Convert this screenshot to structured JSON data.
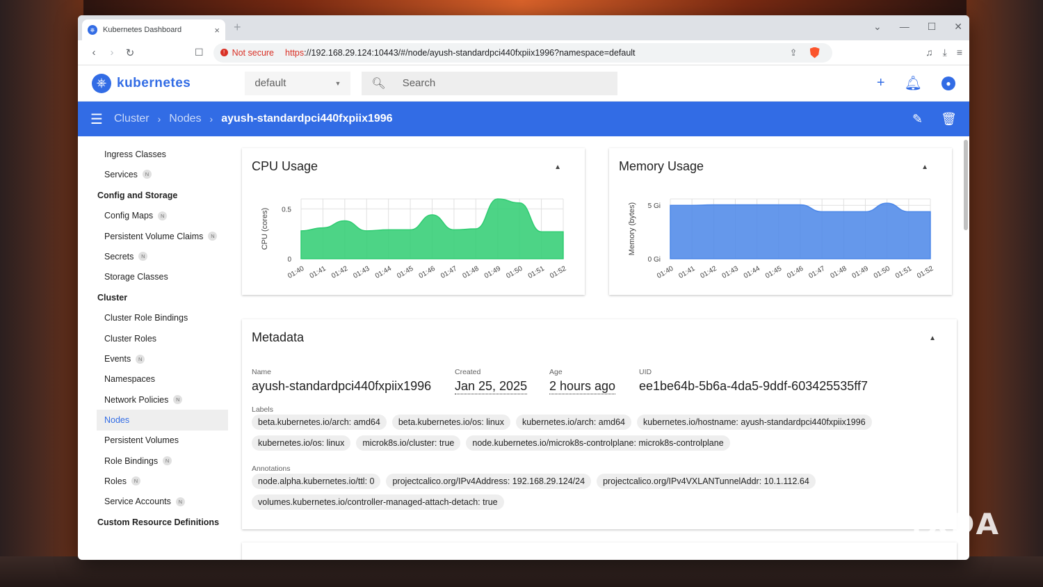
{
  "browser": {
    "tab_title": "Kubernetes Dashboard",
    "tab_close": "×",
    "new_tab": "+",
    "window_controls": [
      "⌄",
      "—",
      "☐",
      "✕"
    ],
    "not_secure_label": "Not secure",
    "url_scheme": "https",
    "url_rest": "://192.168.29.124:10443/#/node/ayush-standardpci440fxpiix1996?namespace=default"
  },
  "header": {
    "logo_text": "kubernetes",
    "namespace_value": "default",
    "search_placeholder": "Search"
  },
  "breadcrumb": {
    "items": [
      "Cluster",
      "Nodes",
      "ayush-standardpci440fxpiix1996"
    ]
  },
  "sidebar": {
    "groups": [
      {
        "title": "",
        "items": [
          {
            "label": "Ingress Classes",
            "badge": ""
          },
          {
            "label": "Services",
            "badge": "N"
          }
        ]
      },
      {
        "title": "Config and Storage",
        "items": [
          {
            "label": "Config Maps",
            "badge": "N"
          },
          {
            "label": "Persistent Volume Claims",
            "badge": "N"
          },
          {
            "label": "Secrets",
            "badge": "N"
          },
          {
            "label": "Storage Classes",
            "badge": ""
          }
        ]
      },
      {
        "title": "Cluster",
        "items": [
          {
            "label": "Cluster Role Bindings",
            "badge": ""
          },
          {
            "label": "Cluster Roles",
            "badge": ""
          },
          {
            "label": "Events",
            "badge": "N"
          },
          {
            "label": "Namespaces",
            "badge": ""
          },
          {
            "label": "Network Policies",
            "badge": "N"
          },
          {
            "label": "Nodes",
            "badge": "",
            "active": true
          },
          {
            "label": "Persistent Volumes",
            "badge": ""
          },
          {
            "label": "Role Bindings",
            "badge": "N"
          },
          {
            "label": "Roles",
            "badge": "N"
          },
          {
            "label": "Service Accounts",
            "badge": "N"
          }
        ]
      },
      {
        "title": "Custom Resource Definitions",
        "items": []
      }
    ]
  },
  "cpu_card": {
    "title": "CPU Usage",
    "ylabel": "CPU (cores)",
    "yticks": [
      "0",
      "0.5"
    ],
    "xticks": [
      "01:40",
      "01:41",
      "01:42",
      "01:43",
      "01:44",
      "01:45",
      "01:46",
      "01:47",
      "01:48",
      "01:49",
      "01:50",
      "01:51",
      "01:52"
    ]
  },
  "memory_card": {
    "title": "Memory Usage",
    "ylabel": "Memory (bytes)",
    "yticks": [
      "0 Gi",
      "5 Gi"
    ],
    "xticks": [
      "01:40",
      "01:41",
      "01:42",
      "01:43",
      "01:44",
      "01:45",
      "01:46",
      "01:47",
      "01:48",
      "01:49",
      "01:50",
      "01:51",
      "01:52"
    ]
  },
  "chart_data": [
    {
      "type": "area",
      "title": "CPU Usage",
      "ylabel": "CPU (cores)",
      "ylim": [
        0,
        0.6
      ],
      "color": "#2ecc71",
      "x": [
        "01:40",
        "01:41",
        "01:42",
        "01:43",
        "01:44",
        "01:45",
        "01:46",
        "01:47",
        "01:48",
        "01:49",
        "01:50",
        "01:51",
        "01:52"
      ],
      "values": [
        0.28,
        0.31,
        0.38,
        0.28,
        0.29,
        0.29,
        0.44,
        0.29,
        0.3,
        0.6,
        0.56,
        0.27,
        0.27
      ]
    },
    {
      "type": "area",
      "title": "Memory Usage",
      "ylabel": "Memory (bytes)",
      "ylim": [
        0,
        5.6
      ],
      "color": "#4a86e8",
      "x": [
        "01:40",
        "01:41",
        "01:42",
        "01:43",
        "01:44",
        "01:45",
        "01:46",
        "01:47",
        "01:48",
        "01:49",
        "01:50",
        "01:51",
        "01:52"
      ],
      "values": [
        5.0,
        5.0,
        5.05,
        5.05,
        5.05,
        5.05,
        5.05,
        4.4,
        4.4,
        4.4,
        5.2,
        4.4,
        4.4
      ]
    }
  ],
  "metadata": {
    "title": "Metadata",
    "name_label": "Name",
    "name_value": "ayush-standardpci440fxpiix1996",
    "created_label": "Created",
    "created_value": "Jan 25, 2025",
    "age_label": "Age",
    "age_value": "2 hours ago",
    "uid_label": "UID",
    "uid_value": "ee1be64b-5b6a-4da5-9ddf-603425535ff7",
    "labels_label": "Labels",
    "labels": [
      "beta.kubernetes.io/arch: amd64",
      "beta.kubernetes.io/os: linux",
      "kubernetes.io/arch: amd64",
      "kubernetes.io/hostname: ayush-standardpci440fxpiix1996",
      "kubernetes.io/os: linux",
      "microk8s.io/cluster: true",
      "node.kubernetes.io/microk8s-controlplane: microk8s-controlplane"
    ],
    "annotations_label": "Annotations",
    "annotations": [
      "node.alpha.kubernetes.io/ttl: 0",
      "projectcalico.org/IPv4Address: 192.168.29.124/24",
      "projectcalico.org/IPv4VXLANTunnelAddr: 10.1.112.64",
      "volumes.kubernetes.io/controller-managed-attach-detach: true"
    ]
  },
  "watermark": "XDA"
}
